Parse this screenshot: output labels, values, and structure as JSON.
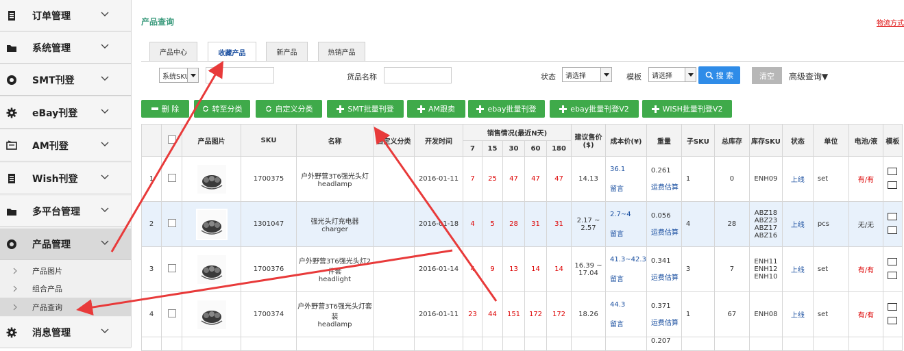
{
  "sidebar": {
    "items": [
      {
        "label": "订单管理",
        "icon": "document-icon"
      },
      {
        "label": "系统管理",
        "icon": "folder-icon"
      },
      {
        "label": "SMT刊登",
        "icon": "circle-settings-icon"
      },
      {
        "label": "eBay刊登",
        "icon": "gear-icon"
      },
      {
        "label": "AM刊登",
        "icon": "monitor-icon"
      },
      {
        "label": "Wish刊登",
        "icon": "document-icon"
      },
      {
        "label": "多平台管理",
        "icon": "folder-icon"
      },
      {
        "label": "产品管理",
        "icon": "circle-settings-icon"
      }
    ],
    "subitems": [
      "产品图片",
      "组合产品",
      "产品查询"
    ],
    "last_item": {
      "label": "消息管理",
      "icon": "gear-icon"
    }
  },
  "page": {
    "title": "产品查询",
    "top_link": "物流方式及报价"
  },
  "tabs": [
    "产品中心",
    "收藏产品",
    "新产品",
    "热销产品"
  ],
  "filters": {
    "sku_select": "系统SKU",
    "goods_name_label": "货品名称",
    "status_label": "状态",
    "status_value": "请选择",
    "template_label": "模板",
    "template_value": "请选择",
    "search_button": "搜 索",
    "clear_button": "清空",
    "advanced": "高级查询▼"
  },
  "actions": [
    "删 除",
    "转至分类",
    "自定义分类",
    "SMT批量刊登",
    "AM跟卖",
    "ebay批量刊登",
    "ebay批量刊登V2",
    "WISH批量刊登V2"
  ],
  "table": {
    "headers": {
      "image": "产品图片",
      "sku": "SKU",
      "name": "名称",
      "custom": "自定义分类",
      "dev_time": "开发时间",
      "sales": "销售情况(最近N天)",
      "sales_days": [
        "7",
        "15",
        "30",
        "60",
        "180"
      ],
      "price": "建议售价($)",
      "cost": "成本价(¥)",
      "weight": "重量",
      "sub_sku": "子SKU",
      "total_stock": "总库存",
      "stock_sku": "库存SKU",
      "status": "状态",
      "unit": "单位",
      "battery": "电池/液",
      "template": "模板"
    },
    "rows": [
      {
        "no": "1",
        "sku": "1700375",
        "name1": "户外野营3T6强光头灯",
        "name2": "headlamp",
        "date": "2016-01-11",
        "sales": [
          "7",
          "25",
          "47",
          "47",
          "47"
        ],
        "price": "14.13",
        "cost": "36.1",
        "cost_note": "留言",
        "weight": "0.261",
        "freight": "运费估算",
        "sub_sku": "1",
        "stock": "0",
        "stock_sku": "ENH09",
        "status": "上线",
        "unit": "set",
        "battery": "有/有"
      },
      {
        "no": "2",
        "sku": "1301047",
        "name1": "强光头灯充电器",
        "name2": "charger",
        "date": "2016-01-18",
        "sales": [
          "4",
          "5",
          "28",
          "31",
          "31"
        ],
        "price": "2.17 ~ 2.57",
        "cost": "2.7~4",
        "cost_note": "留言",
        "weight": "0.056",
        "freight": "运费估算",
        "sub_sku": "4",
        "stock": "28",
        "stock_sku": "ABZ18 ABZ23 ABZ17 ABZ16",
        "status": "上线",
        "unit": "pcs",
        "battery": "无/无"
      },
      {
        "no": "3",
        "sku": "1700376",
        "name1": "户外野营3T6强光头灯2件套",
        "name2": "headlight",
        "date": "2016-01-14",
        "sales": [
          "4",
          "9",
          "13",
          "14",
          "14"
        ],
        "price": "16.39 ~ 17.04",
        "cost": "41.3~42.3",
        "cost_note": "留言",
        "weight": "0.341",
        "freight": "运费估算",
        "sub_sku": "3",
        "stock": "7",
        "stock_sku": "ENH11 ENH12 ENH10",
        "status": "上线",
        "unit": "set",
        "battery": "有/有"
      },
      {
        "no": "4",
        "sku": "1700374",
        "name1": "户外野营3T6强光头灯套装",
        "name2": "headlamp",
        "date": "2016-01-11",
        "sales": [
          "23",
          "44",
          "151",
          "172",
          "172"
        ],
        "price": "18.26",
        "cost": "44.3",
        "cost_note": "留言",
        "weight": "0.371",
        "freight": "运费估算",
        "sub_sku": "1",
        "stock": "67",
        "stock_sku": "ENH08",
        "status": "上线",
        "unit": "set",
        "battery": "有/有"
      }
    ],
    "partial_row_weight": "0.207"
  },
  "colors": {
    "accent_green": "#3faa4a",
    "title_teal": "#3a9a7c",
    "link_blue": "#1a4fa0",
    "sales_red": "#dd0000",
    "arrow_red": "#e83a3a"
  }
}
